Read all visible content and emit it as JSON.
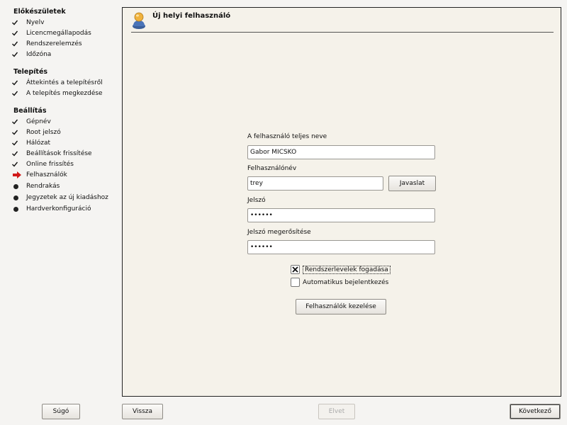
{
  "sidebar": {
    "sections": [
      {
        "title": "Előkészületek",
        "steps": [
          {
            "label": "Nyelv",
            "status": "done"
          },
          {
            "label": "Licencmegállapodás",
            "status": "done"
          },
          {
            "label": "Rendszerelemzés",
            "status": "done"
          },
          {
            "label": "Időzóna",
            "status": "done"
          }
        ]
      },
      {
        "title": "Telepítés",
        "steps": [
          {
            "label": "Áttekintés a telepítésről",
            "status": "done"
          },
          {
            "label": "A telepítés megkezdése",
            "status": "done"
          }
        ]
      },
      {
        "title": "Beállítás",
        "steps": [
          {
            "label": "Gépnév",
            "status": "done"
          },
          {
            "label": "Root jelszó",
            "status": "done"
          },
          {
            "label": "Hálózat",
            "status": "done"
          },
          {
            "label": "Beállítások frissítése",
            "status": "done"
          },
          {
            "label": "Online frissítés",
            "status": "done"
          },
          {
            "label": "Felhasználók",
            "status": "current"
          },
          {
            "label": "Rendrakás",
            "status": "pending"
          },
          {
            "label": "Jegyzetek az új kiadáshoz",
            "status": "pending"
          },
          {
            "label": "Hardverkonfiguráció",
            "status": "pending"
          }
        ]
      }
    ]
  },
  "panel": {
    "title": "Új helyi felhasználó",
    "icon": "user-icon"
  },
  "form": {
    "fullname": {
      "label": "A felhasználó teljes neve",
      "value": "Gabor MICSKO"
    },
    "username": {
      "label": "Felhasználónév",
      "value": "trey"
    },
    "suggest_button": "Javaslat",
    "password": {
      "label": "Jelszó",
      "value": "••••••"
    },
    "password_confirm": {
      "label": "Jelszó megerősítése",
      "value": "••••••"
    },
    "receive_mail": {
      "label": "Rendszerlevelek fogadása",
      "checked": true
    },
    "auto_login": {
      "label": "Automatikus bejelentkezés",
      "checked": false
    },
    "manage_users_button": "Felhasználók kezelése"
  },
  "footer": {
    "help": "Súgó",
    "back": "Vissza",
    "abort": "Elvet",
    "next": "Következő"
  },
  "colors": {
    "panel_bg": "#f5f2ea",
    "window_bg": "#f5f4f2",
    "current_arrow": "#d11a1a"
  }
}
